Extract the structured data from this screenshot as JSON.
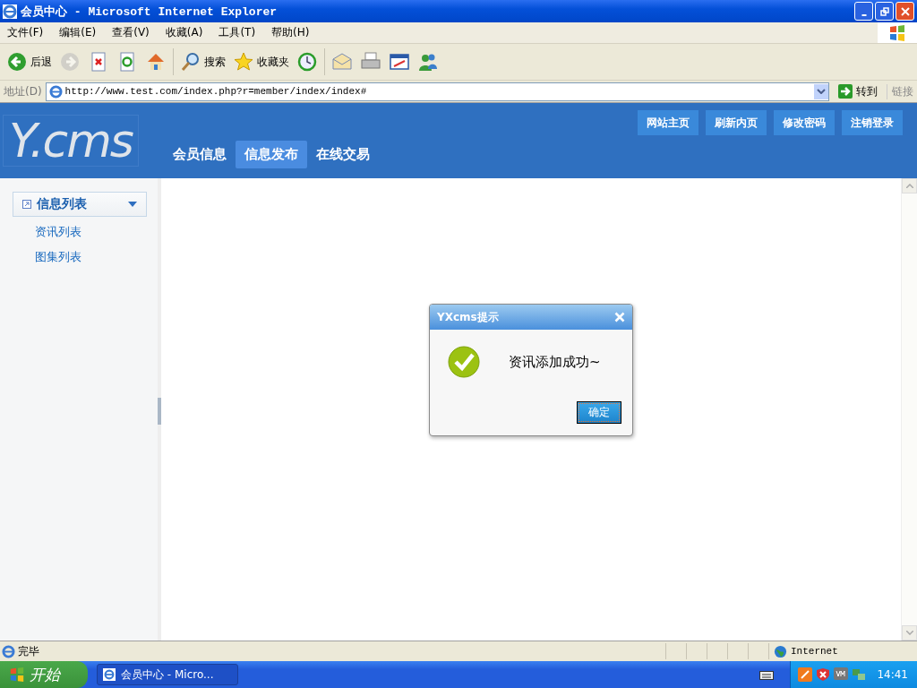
{
  "window": {
    "title": "会员中心 - Microsoft Internet Explorer"
  },
  "menu": [
    "文件(F)",
    "编辑(E)",
    "查看(V)",
    "收藏(A)",
    "工具(T)",
    "帮助(H)"
  ],
  "toolbar": [
    {
      "kind": "back",
      "label": "后退",
      "disabled": false
    },
    {
      "kind": "forward",
      "disabled": true
    },
    {
      "kind": "stop",
      "disabled": false
    },
    {
      "kind": "refresh",
      "disabled": false
    },
    {
      "kind": "home",
      "disabled": false
    },
    {
      "kind": "search",
      "label": "搜索",
      "disabled": false
    },
    {
      "kind": "favorites",
      "label": "收藏夹",
      "disabled": false
    },
    {
      "kind": "history",
      "disabled": false
    },
    {
      "kind": "mail",
      "disabled": false
    },
    {
      "kind": "print",
      "disabled": false
    },
    {
      "kind": "edit",
      "disabled": false
    },
    {
      "kind": "messenger",
      "disabled": false
    }
  ],
  "address": {
    "label": "地址(D)",
    "value": "http://www.test.com/index.php?r=member/index/index#",
    "go": "转到",
    "links": "链接"
  },
  "site": {
    "logo": "Y.cms",
    "nav": [
      {
        "label": "会员信息",
        "selected": false
      },
      {
        "label": "信息发布",
        "selected": true
      },
      {
        "label": "在线交易",
        "selected": false
      }
    ],
    "top_links": [
      "网站主页",
      "刷新内页",
      "修改密码",
      "注销登录"
    ]
  },
  "sidebar": {
    "group": "信息列表",
    "items": [
      "资讯列表",
      "图集列表"
    ]
  },
  "dialog": {
    "title": "YXcms提示",
    "message": "资讯添加成功~",
    "button": "确定"
  },
  "status_bar": {
    "text": "完毕",
    "zone": "Internet"
  },
  "taskbar": {
    "start": "开始",
    "task": "会员中心 - Micro...",
    "clock": "14:41"
  }
}
